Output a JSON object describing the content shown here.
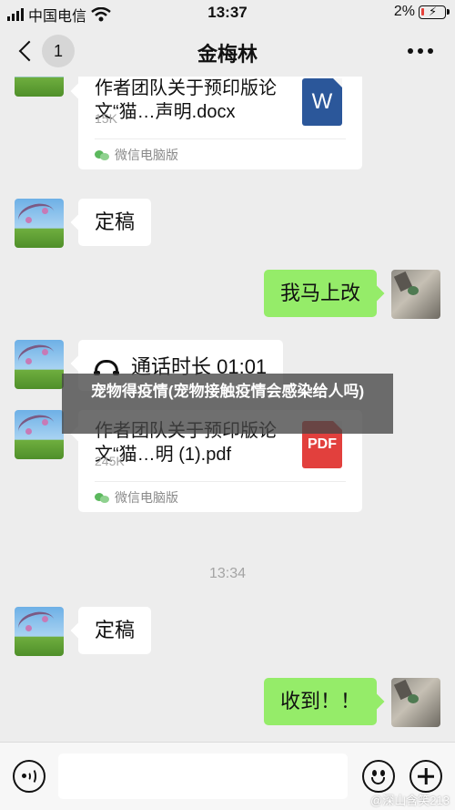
{
  "status_bar": {
    "carrier": "中国电信",
    "time": "13:37",
    "battery": "2%",
    "battery_level_percent": 2,
    "icons": [
      "signal-icon",
      "wifi-icon",
      "battery-charging-icon"
    ]
  },
  "nav": {
    "unread_count": "1",
    "title": "金梅林",
    "icons": [
      "chevron-left-icon",
      "more-icon"
    ]
  },
  "messages": [
    {
      "side": "left",
      "type": "file",
      "file_name": "作者团队关于预印版论文“猫…声明.docx",
      "file_size": "15K",
      "file_type": "W",
      "source": "微信电脑版"
    },
    {
      "side": "left",
      "type": "text",
      "text": "定稿"
    },
    {
      "side": "right",
      "type": "text",
      "text": "我马上改"
    },
    {
      "side": "left",
      "type": "call",
      "text": "通话时长 01:01"
    },
    {
      "side": "left",
      "type": "file",
      "file_name": "作者团队关于预印版论文“猫…明 (1).pdf",
      "file_size": "245K",
      "file_type": "PDF",
      "source": "微信电脑版"
    },
    {
      "type": "timestamp",
      "text": "13:34"
    },
    {
      "side": "left",
      "type": "text",
      "text": "定稿"
    },
    {
      "side": "right",
      "type": "text",
      "text": "收到！！"
    }
  ],
  "overlay_caption": "宠物得疫情(宠物接触疫情会感染给人吗)",
  "input_bar": {
    "icons": [
      "voice-icon",
      "emoji-icon",
      "plus-icon"
    ],
    "placeholder": ""
  },
  "watermark": "@深山含笑213",
  "colors": {
    "background": "#ededed",
    "sent_bubble": "#95ec69",
    "received_bubble": "#ffffff",
    "word_icon": "#2b579a",
    "pdf_icon": "#e2403d"
  }
}
